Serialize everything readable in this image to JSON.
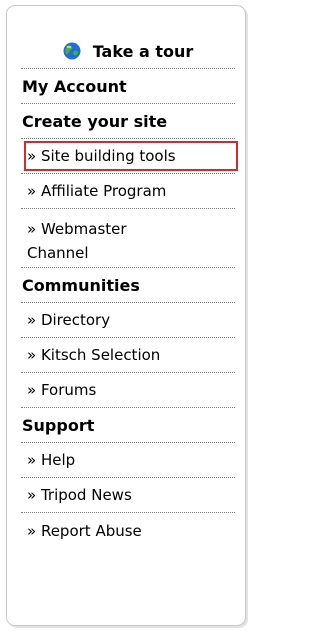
{
  "tour": {
    "label": "Take a tour",
    "icon": "globe-icon"
  },
  "menu": [
    {
      "type": "header",
      "label": "My Account"
    },
    {
      "type": "header",
      "label": "Create your site"
    },
    {
      "type": "link",
      "label": "» Site building tools",
      "highlighted": true
    },
    {
      "type": "link",
      "label": "» Affiliate Program"
    },
    {
      "type": "link",
      "label": "» Webmaster Channel"
    },
    {
      "type": "header",
      "label": "Communities"
    },
    {
      "type": "link",
      "label": "» Directory"
    },
    {
      "type": "link",
      "label": "» Kitsch Selection"
    },
    {
      "type": "link",
      "label": "» Forums"
    },
    {
      "type": "header",
      "label": "Support"
    },
    {
      "type": "link",
      "label": "» Help"
    },
    {
      "type": "link",
      "label": "» Tripod News"
    },
    {
      "type": "link",
      "label": "» Report Abuse"
    }
  ],
  "colors": {
    "highlight_border": "#d42a2a",
    "globe_blue": "#1f6fd8",
    "globe_green": "#4caf3a",
    "panel_border": "#c9c9c9"
  }
}
